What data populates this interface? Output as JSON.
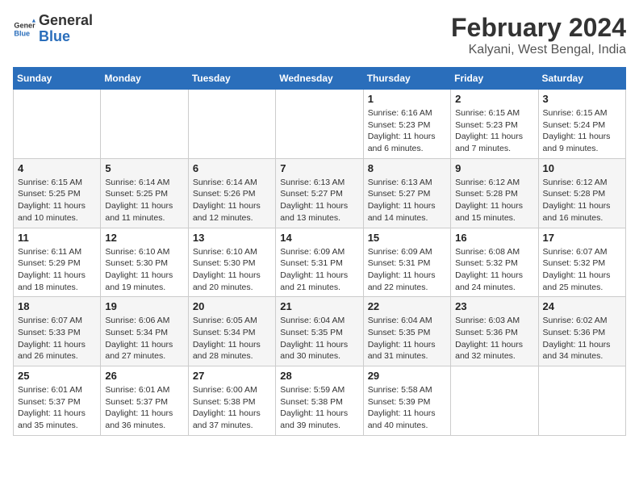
{
  "header": {
    "logo_line1": "General",
    "logo_line2": "Blue",
    "title": "February 2024",
    "subtitle": "Kalyani, West Bengal, India"
  },
  "days_of_week": [
    "Sunday",
    "Monday",
    "Tuesday",
    "Wednesday",
    "Thursday",
    "Friday",
    "Saturday"
  ],
  "weeks": [
    [
      {
        "day": "",
        "sunrise": "",
        "sunset": "",
        "daylight": ""
      },
      {
        "day": "",
        "sunrise": "",
        "sunset": "",
        "daylight": ""
      },
      {
        "day": "",
        "sunrise": "",
        "sunset": "",
        "daylight": ""
      },
      {
        "day": "",
        "sunrise": "",
        "sunset": "",
        "daylight": ""
      },
      {
        "day": "1",
        "sunrise": "Sunrise: 6:16 AM",
        "sunset": "Sunset: 5:23 PM",
        "daylight": "Daylight: 11 hours and 6 minutes."
      },
      {
        "day": "2",
        "sunrise": "Sunrise: 6:15 AM",
        "sunset": "Sunset: 5:23 PM",
        "daylight": "Daylight: 11 hours and 7 minutes."
      },
      {
        "day": "3",
        "sunrise": "Sunrise: 6:15 AM",
        "sunset": "Sunset: 5:24 PM",
        "daylight": "Daylight: 11 hours and 9 minutes."
      }
    ],
    [
      {
        "day": "4",
        "sunrise": "Sunrise: 6:15 AM",
        "sunset": "Sunset: 5:25 PM",
        "daylight": "Daylight: 11 hours and 10 minutes."
      },
      {
        "day": "5",
        "sunrise": "Sunrise: 6:14 AM",
        "sunset": "Sunset: 5:25 PM",
        "daylight": "Daylight: 11 hours and 11 minutes."
      },
      {
        "day": "6",
        "sunrise": "Sunrise: 6:14 AM",
        "sunset": "Sunset: 5:26 PM",
        "daylight": "Daylight: 11 hours and 12 minutes."
      },
      {
        "day": "7",
        "sunrise": "Sunrise: 6:13 AM",
        "sunset": "Sunset: 5:27 PM",
        "daylight": "Daylight: 11 hours and 13 minutes."
      },
      {
        "day": "8",
        "sunrise": "Sunrise: 6:13 AM",
        "sunset": "Sunset: 5:27 PM",
        "daylight": "Daylight: 11 hours and 14 minutes."
      },
      {
        "day": "9",
        "sunrise": "Sunrise: 6:12 AM",
        "sunset": "Sunset: 5:28 PM",
        "daylight": "Daylight: 11 hours and 15 minutes."
      },
      {
        "day": "10",
        "sunrise": "Sunrise: 6:12 AM",
        "sunset": "Sunset: 5:28 PM",
        "daylight": "Daylight: 11 hours and 16 minutes."
      }
    ],
    [
      {
        "day": "11",
        "sunrise": "Sunrise: 6:11 AM",
        "sunset": "Sunset: 5:29 PM",
        "daylight": "Daylight: 11 hours and 18 minutes."
      },
      {
        "day": "12",
        "sunrise": "Sunrise: 6:10 AM",
        "sunset": "Sunset: 5:30 PM",
        "daylight": "Daylight: 11 hours and 19 minutes."
      },
      {
        "day": "13",
        "sunrise": "Sunrise: 6:10 AM",
        "sunset": "Sunset: 5:30 PM",
        "daylight": "Daylight: 11 hours and 20 minutes."
      },
      {
        "day": "14",
        "sunrise": "Sunrise: 6:09 AM",
        "sunset": "Sunset: 5:31 PM",
        "daylight": "Daylight: 11 hours and 21 minutes."
      },
      {
        "day": "15",
        "sunrise": "Sunrise: 6:09 AM",
        "sunset": "Sunset: 5:31 PM",
        "daylight": "Daylight: 11 hours and 22 minutes."
      },
      {
        "day": "16",
        "sunrise": "Sunrise: 6:08 AM",
        "sunset": "Sunset: 5:32 PM",
        "daylight": "Daylight: 11 hours and 24 minutes."
      },
      {
        "day": "17",
        "sunrise": "Sunrise: 6:07 AM",
        "sunset": "Sunset: 5:32 PM",
        "daylight": "Daylight: 11 hours and 25 minutes."
      }
    ],
    [
      {
        "day": "18",
        "sunrise": "Sunrise: 6:07 AM",
        "sunset": "Sunset: 5:33 PM",
        "daylight": "Daylight: 11 hours and 26 minutes."
      },
      {
        "day": "19",
        "sunrise": "Sunrise: 6:06 AM",
        "sunset": "Sunset: 5:34 PM",
        "daylight": "Daylight: 11 hours and 27 minutes."
      },
      {
        "day": "20",
        "sunrise": "Sunrise: 6:05 AM",
        "sunset": "Sunset: 5:34 PM",
        "daylight": "Daylight: 11 hours and 28 minutes."
      },
      {
        "day": "21",
        "sunrise": "Sunrise: 6:04 AM",
        "sunset": "Sunset: 5:35 PM",
        "daylight": "Daylight: 11 hours and 30 minutes."
      },
      {
        "day": "22",
        "sunrise": "Sunrise: 6:04 AM",
        "sunset": "Sunset: 5:35 PM",
        "daylight": "Daylight: 11 hours and 31 minutes."
      },
      {
        "day": "23",
        "sunrise": "Sunrise: 6:03 AM",
        "sunset": "Sunset: 5:36 PM",
        "daylight": "Daylight: 11 hours and 32 minutes."
      },
      {
        "day": "24",
        "sunrise": "Sunrise: 6:02 AM",
        "sunset": "Sunset: 5:36 PM",
        "daylight": "Daylight: 11 hours and 34 minutes."
      }
    ],
    [
      {
        "day": "25",
        "sunrise": "Sunrise: 6:01 AM",
        "sunset": "Sunset: 5:37 PM",
        "daylight": "Daylight: 11 hours and 35 minutes."
      },
      {
        "day": "26",
        "sunrise": "Sunrise: 6:01 AM",
        "sunset": "Sunset: 5:37 PM",
        "daylight": "Daylight: 11 hours and 36 minutes."
      },
      {
        "day": "27",
        "sunrise": "Sunrise: 6:00 AM",
        "sunset": "Sunset: 5:38 PM",
        "daylight": "Daylight: 11 hours and 37 minutes."
      },
      {
        "day": "28",
        "sunrise": "Sunrise: 5:59 AM",
        "sunset": "Sunset: 5:38 PM",
        "daylight": "Daylight: 11 hours and 39 minutes."
      },
      {
        "day": "29",
        "sunrise": "Sunrise: 5:58 AM",
        "sunset": "Sunset: 5:39 PM",
        "daylight": "Daylight: 11 hours and 40 minutes."
      },
      {
        "day": "",
        "sunrise": "",
        "sunset": "",
        "daylight": ""
      },
      {
        "day": "",
        "sunrise": "",
        "sunset": "",
        "daylight": ""
      }
    ]
  ]
}
